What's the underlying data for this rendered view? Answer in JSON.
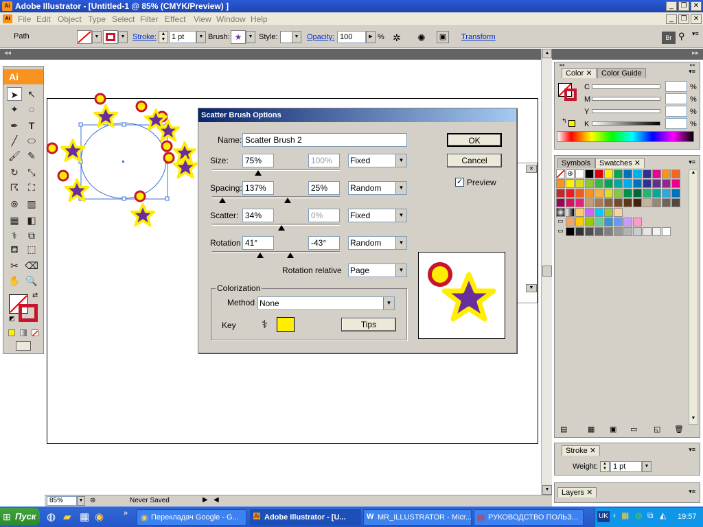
{
  "window": {
    "title": "Adobe Illustrator - [Untitled-1 @ 85% (CMYK/Preview) ]",
    "logo": "Ai"
  },
  "menu": [
    "File",
    "Edit",
    "Object",
    "Type",
    "Select",
    "Filter",
    "Effect",
    "View",
    "Window",
    "Help"
  ],
  "control": {
    "selection": "Path",
    "stroke_label": "Stroke:",
    "stroke_value": "1 pt",
    "brush_label": "Brush:",
    "style_label": "Style:",
    "opacity_label": "Opacity:",
    "opacity_value": "100",
    "percent": "%",
    "transform": "Transform"
  },
  "toolbox": {
    "logo": "Ai",
    "tools": [
      "selection-icon",
      "direct-select-icon",
      "magic-wand-icon",
      "lasso-icon",
      "pen-icon",
      "type-icon",
      "line-icon",
      "ellipse-icon",
      "paintbrush-icon",
      "pencil-icon",
      "rotate-icon",
      "scale-icon",
      "warp-icon",
      "free-transform-icon",
      "symbol-sprayer-icon",
      "graph-icon",
      "mesh-icon",
      "gradient-icon",
      "eyedropper-icon",
      "blend-icon",
      "live-paint-icon",
      "live-paint-select-icon",
      "slice-icon",
      "eraser-icon",
      "hand-icon",
      "zoom-icon"
    ]
  },
  "status": {
    "zoom": "85%",
    "saved": "Never Saved"
  },
  "color_panel": {
    "tabs": [
      "Color",
      "Color Guide"
    ],
    "channels": [
      {
        "name": "C",
        "value": ""
      },
      {
        "name": "M",
        "value": ""
      },
      {
        "name": "Y",
        "value": ""
      },
      {
        "name": "K",
        "value": ""
      }
    ],
    "percent": "%"
  },
  "swatches_panel": {
    "tabs": [
      "Symbols",
      "Swatches"
    ]
  },
  "stroke_panel": {
    "tab": "Stroke",
    "weight_label": "Weight:",
    "weight_value": "1 pt"
  },
  "layers_panel": {
    "tab": "Layers"
  },
  "dialog": {
    "title": "Scatter Brush Options",
    "name_label": "Name:",
    "name_value": "Scatter Brush 2",
    "ok": "OK",
    "cancel": "Cancel",
    "preview": "Preview",
    "size": {
      "label": "Size:",
      "v1": "75%",
      "v2": "100%",
      "mode": "Fixed"
    },
    "spacing": {
      "label": "Spacing:",
      "v1": "137%",
      "v2": "25%",
      "mode": "Random"
    },
    "scatter": {
      "label": "Scatter:",
      "v1": "34%",
      "v2": "0%",
      "mode": "Fixed"
    },
    "rotation": {
      "label": "Rotation",
      "v1": "41°",
      "v2": "-43°",
      "mode": "Random"
    },
    "rotation_relative_label": "Rotation relative",
    "rotation_relative_value": "Page",
    "colorization": "Colorization",
    "method_label": "Method",
    "method_value": "None",
    "key_label": "Key",
    "tips": "Tips",
    "key_color": "#ffee00"
  },
  "taskbar": {
    "start": "Пуск",
    "tasks": [
      "Перекладач Google - G...",
      "Adobe Illustrator - [U...",
      "MR_ILLUSTRATOR - Micr...",
      "РУКОВОДСТВО ПОЛЬЗ..."
    ],
    "lang": "UK",
    "clock": "19:57"
  },
  "colors": {
    "star": "#6a2d9c",
    "star_outline": "#ffee00",
    "circle_ring": "#c8142c",
    "circle_fill": "#ffee00"
  }
}
